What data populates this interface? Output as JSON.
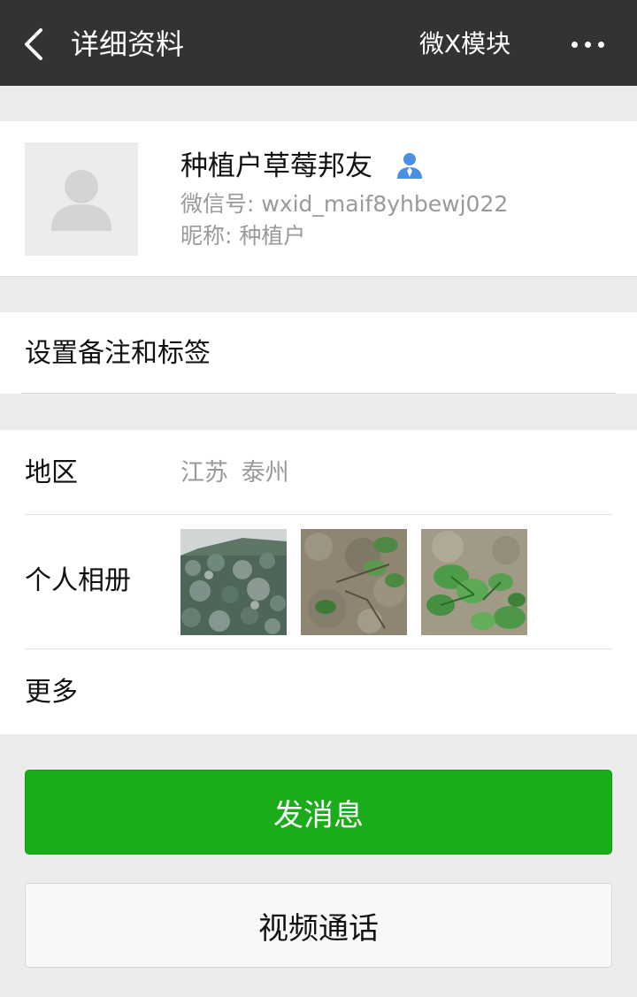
{
  "header": {
    "title": "详细资料",
    "plugin_label": "微X模块",
    "back_icon": "chevron-left-icon",
    "more_icon": "more-dots-icon"
  },
  "profile": {
    "name": "种植户草莓邦友",
    "wechat_id": "微信号: wxid_maif8yhbewj022",
    "nickname": "昵称: 种植户",
    "contact_icon": "person-contact-icon",
    "contact_icon_color": "#4a90e2"
  },
  "remark": {
    "label": "设置备注和标签"
  },
  "details": {
    "region_label": "地区",
    "region_value": "江苏  泰州",
    "album_label": "个人相册",
    "more_label": "更多"
  },
  "actions": {
    "send_message": "发消息",
    "video_call": "视频通话"
  },
  "colors": {
    "topbar": "#333335",
    "primary_green": "#1aad19",
    "background": "#ececec",
    "secondary_text": "#9a9a9a"
  }
}
